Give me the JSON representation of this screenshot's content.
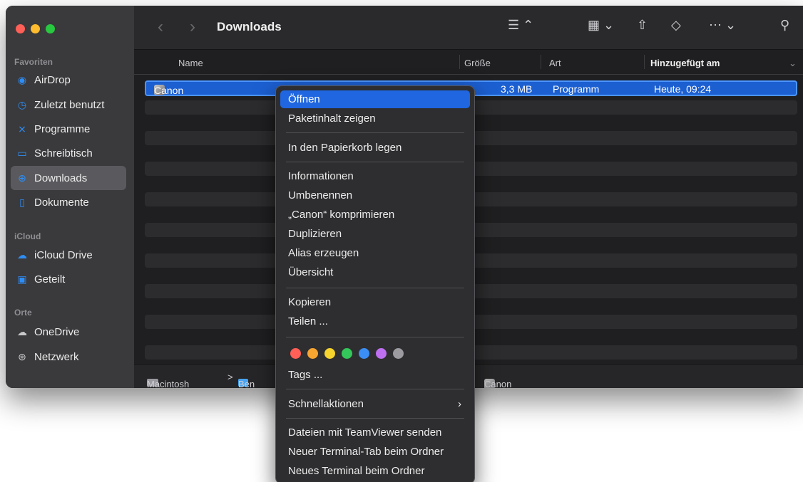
{
  "window": {
    "title": "Downloads"
  },
  "sidebar": {
    "sections": {
      "favorites": "Favoriten",
      "icloud": "iCloud",
      "places": "Orte"
    },
    "items": [
      {
        "label": "AirDrop",
        "icon": "airdrop-icon"
      },
      {
        "label": "Zuletzt benutzt",
        "icon": "clock-icon"
      },
      {
        "label": "Programme",
        "icon": "applications-icon"
      },
      {
        "label": "Schreibtisch",
        "icon": "desktop-icon"
      },
      {
        "label": "Downloads",
        "icon": "download-icon",
        "active": true
      },
      {
        "label": "Dokumente",
        "icon": "document-icon"
      },
      {
        "label": "iCloud Drive",
        "icon": "cloud-icon"
      },
      {
        "label": "Geteilt",
        "icon": "shared-folder-icon"
      },
      {
        "label": "OneDrive",
        "icon": "cloud-icon"
      },
      {
        "label": "Netzwerk",
        "icon": "network-globe-icon"
      }
    ]
  },
  "columns": {
    "name": "Name",
    "size": "Größe",
    "kind": "Art",
    "date_added": "Hinzugefügt am"
  },
  "files": [
    {
      "name": "Canon",
      "size": "3,3 MB",
      "kind": "Programm",
      "date_added": "Heute, 09:24",
      "selected": true
    }
  ],
  "pathbar": {
    "disk": "Macintosh HD",
    "user": "Ben",
    "separator": ">",
    "item": "Canon"
  },
  "context_menu": {
    "groups": [
      [
        "Öffnen",
        "Paketinhalt zeigen"
      ],
      [
        "In den Papierkorb legen"
      ],
      [
        "Informationen",
        "Umbenennen",
        "„Canon“ komprimieren",
        "Duplizieren",
        "Alias erzeugen",
        "Übersicht"
      ],
      [
        "Kopieren",
        "Teilen ..."
      ],
      [
        "Tags ..."
      ],
      [
        "Schnellaktionen"
      ],
      [
        "Dateien mit TeamViewer senden",
        "Neuer Terminal-Tab beim Ordner",
        "Neues Terminal beim Ordner"
      ]
    ],
    "highlighted": "Öffnen",
    "tag_colors": [
      "#fe5f57",
      "#f7a531",
      "#f6d32d",
      "#34c759",
      "#3b8ef5",
      "#bf6ff2",
      "#9b9ba0"
    ]
  }
}
